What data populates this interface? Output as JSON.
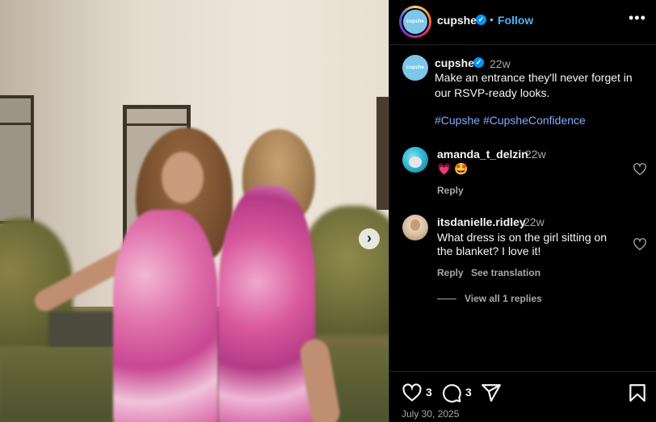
{
  "media": {
    "next_icon": "chevron-right-icon",
    "next_glyph": "›"
  },
  "header": {
    "username": "cupshe",
    "avatar_text": "cupshe",
    "verified_glyph": "✓",
    "separator": "•",
    "follow_label": "Follow",
    "more_icon": "more-horizontal-icon",
    "more_glyph": "•••"
  },
  "caption": {
    "username": "cupshe",
    "avatar_text": "cupshe",
    "time": "22w",
    "text": "Make an entrance they'll never forget in our RSVP-ready looks.",
    "hashtags": [
      "#Cupshe",
      "#CupsheConfidence"
    ]
  },
  "comments": [
    {
      "username": "amanda_t_delzin",
      "time": "22w",
      "text": "💗 🤩",
      "reply_label": "Reply"
    },
    {
      "username": "itsdanielle.ridley",
      "time": "22w",
      "text": "What dress is on the girl sitting on the blanket? I love it!",
      "reply_label": "Reply",
      "translate_label": "See translation",
      "view_replies_label": "View all 1 replies"
    }
  ],
  "footer": {
    "like_count": "3",
    "comment_count": "3",
    "date": "July 30, 2025"
  },
  "colors": {
    "accent_link": "#4cb5f9",
    "hashtag": "#7faeff",
    "verified": "#0095f6",
    "muted_text": "#a8a8a8"
  }
}
